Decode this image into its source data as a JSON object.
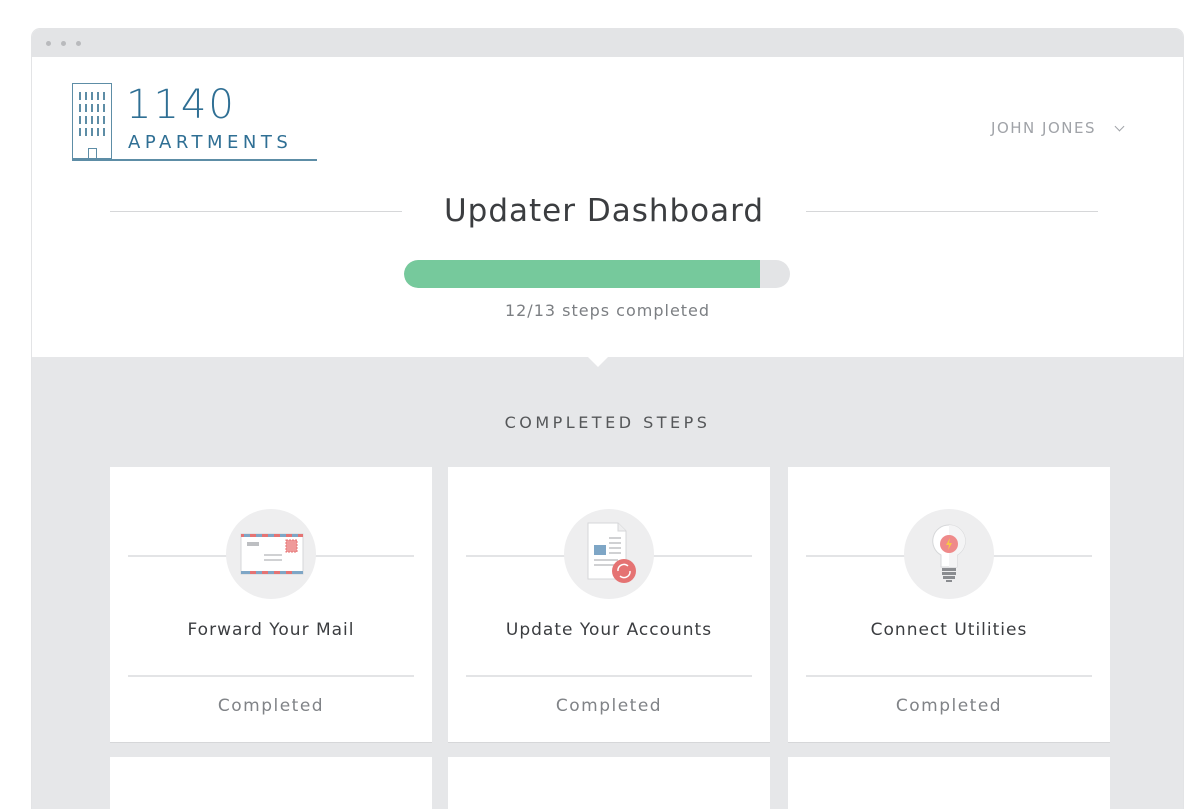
{
  "logo": {
    "number": "1140",
    "name": "APARTMENTS"
  },
  "user": {
    "name": "JOHN JONES"
  },
  "dashboard": {
    "title": "Updater Dashboard",
    "progress": {
      "completed": 12,
      "total": 13
    },
    "steps_text": "12/13 steps completed"
  },
  "section": {
    "title": "COMPLETED STEPS"
  },
  "cards": [
    {
      "title": "Forward Your Mail",
      "status": "Completed",
      "icon": "envelope-icon"
    },
    {
      "title": "Update Your Accounts",
      "status": "Completed",
      "icon": "document-sync-icon"
    },
    {
      "title": "Connect Utilities",
      "status": "Completed",
      "icon": "lightbulb-icon"
    }
  ],
  "colors": {
    "progress_fill": "#76c99c",
    "progress_track": "#e3e4e6",
    "brand": "#2f6f94",
    "background": "#e6e7e9"
  }
}
